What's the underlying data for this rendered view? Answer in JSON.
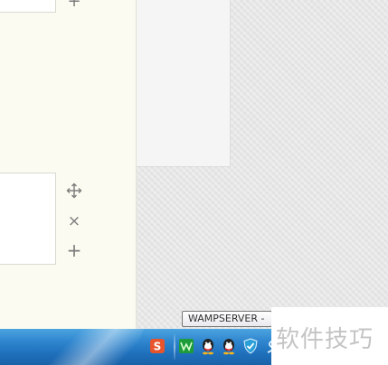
{
  "left_panel": {
    "card_controls": {
      "top_add": "+",
      "move": "move",
      "close": "×",
      "add": "+"
    }
  },
  "taskbar": {
    "tray_icons": [
      "sogou-input-icon",
      "wampserver-icon",
      "qq-icon",
      "qq-icon",
      "shield-security-icon",
      "network-icon"
    ],
    "colors": {
      "bar_top": "#4ba3df",
      "bar_bottom": "#1a62a8"
    }
  },
  "tooltip": {
    "text": "WAMPSERVER - "
  },
  "watermark": {
    "text": "软件技巧"
  }
}
